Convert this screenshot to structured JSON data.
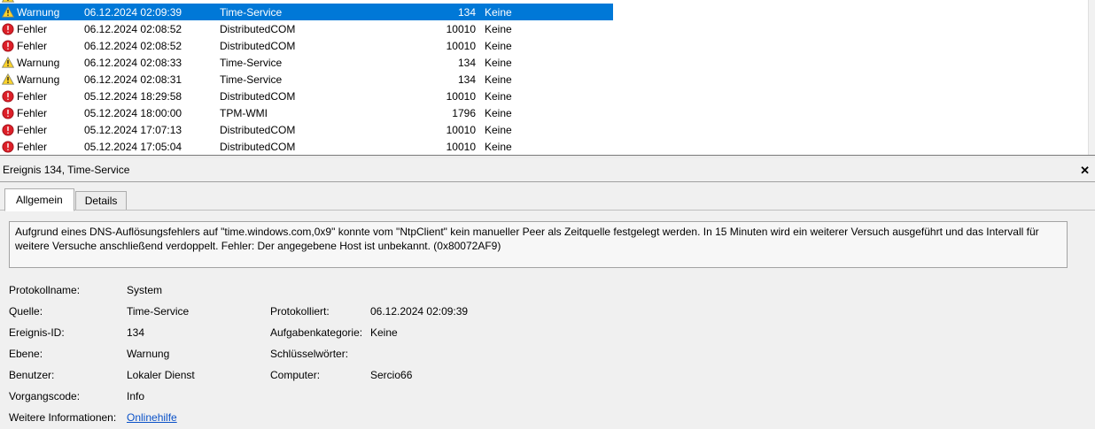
{
  "event_list": {
    "rows": [
      {
        "level": "Warnung",
        "type": "warning",
        "datetime": "06.12.2024 02:09:39",
        "source": "Time-Service",
        "event_id": "134",
        "category": "Keine",
        "selected": true
      },
      {
        "level": "Fehler",
        "type": "error",
        "datetime": "06.12.2024 02:08:52",
        "source": "DistributedCOM",
        "event_id": "10010",
        "category": "Keine",
        "selected": false
      },
      {
        "level": "Fehler",
        "type": "error",
        "datetime": "06.12.2024 02:08:52",
        "source": "DistributedCOM",
        "event_id": "10010",
        "category": "Keine",
        "selected": false
      },
      {
        "level": "Warnung",
        "type": "warning",
        "datetime": "06.12.2024 02:08:33",
        "source": "Time-Service",
        "event_id": "134",
        "category": "Keine",
        "selected": false
      },
      {
        "level": "Warnung",
        "type": "warning",
        "datetime": "06.12.2024 02:08:31",
        "source": "Time-Service",
        "event_id": "134",
        "category": "Keine",
        "selected": false
      },
      {
        "level": "Fehler",
        "type": "error",
        "datetime": "05.12.2024 18:29:58",
        "source": "DistributedCOM",
        "event_id": "10010",
        "category": "Keine",
        "selected": false
      },
      {
        "level": "Fehler",
        "type": "error",
        "datetime": "05.12.2024 18:00:00",
        "source": "TPM-WMI",
        "event_id": "1796",
        "category": "Keine",
        "selected": false
      },
      {
        "level": "Fehler",
        "type": "error",
        "datetime": "05.12.2024 17:07:13",
        "source": "DistributedCOM",
        "event_id": "10010",
        "category": "Keine",
        "selected": false
      },
      {
        "level": "Fehler",
        "type": "error",
        "datetime": "05.12.2024 17:05:04",
        "source": "DistributedCOM",
        "event_id": "10010",
        "category": "Keine",
        "selected": false
      }
    ]
  },
  "details": {
    "header": "Ereignis 134, Time-Service",
    "tabs": [
      "Allgemein",
      "Details"
    ],
    "active_tab": "Allgemein",
    "description": "Aufgrund eines DNS-Auflösungsfehlers auf \"time.windows.com,0x9\" konnte vom \"NtpClient\" kein manueller Peer als Zeitquelle festgelegt werden. In 15 Minuten wird ein weiterer Versuch ausgeführt und das Intervall für weitere Versuche anschließend verdoppelt. Fehler: Der angegebene Host ist unbekannt. (0x80072AF9)",
    "fields": [
      {
        "label": "Protokollname:",
        "value": "System",
        "label2": "",
        "value2": ""
      },
      {
        "label": "Quelle:",
        "value": "Time-Service",
        "label2": "Protokolliert:",
        "value2": "06.12.2024 02:09:39"
      },
      {
        "label": "Ereignis-ID:",
        "value": "134",
        "label2": "Aufgabenkategorie:",
        "value2": "Keine"
      },
      {
        "label": "Ebene:",
        "value": "Warnung",
        "label2": "Schlüsselwörter:",
        "value2": ""
      },
      {
        "label": "Benutzer:",
        "value": "Lokaler Dienst",
        "label2": "Computer:",
        "value2": "Sercio66"
      },
      {
        "label": "Vorgangscode:",
        "value": "Info",
        "label2": "",
        "value2": ""
      },
      {
        "label": "Weitere Informationen:",
        "value": "Onlinehilfe",
        "label2": "",
        "value2": "",
        "value_is_link": true
      }
    ]
  },
  "icons": {
    "close": "✕",
    "warning": "warning-triangle",
    "error": "error-circle"
  },
  "colors": {
    "selection_blue": "#0078d7",
    "warning_yellow": "#ffd42a",
    "error_red": "#dc1f28",
    "link_blue": "#0a51c8",
    "pane_gray": "#f0f0f0"
  }
}
